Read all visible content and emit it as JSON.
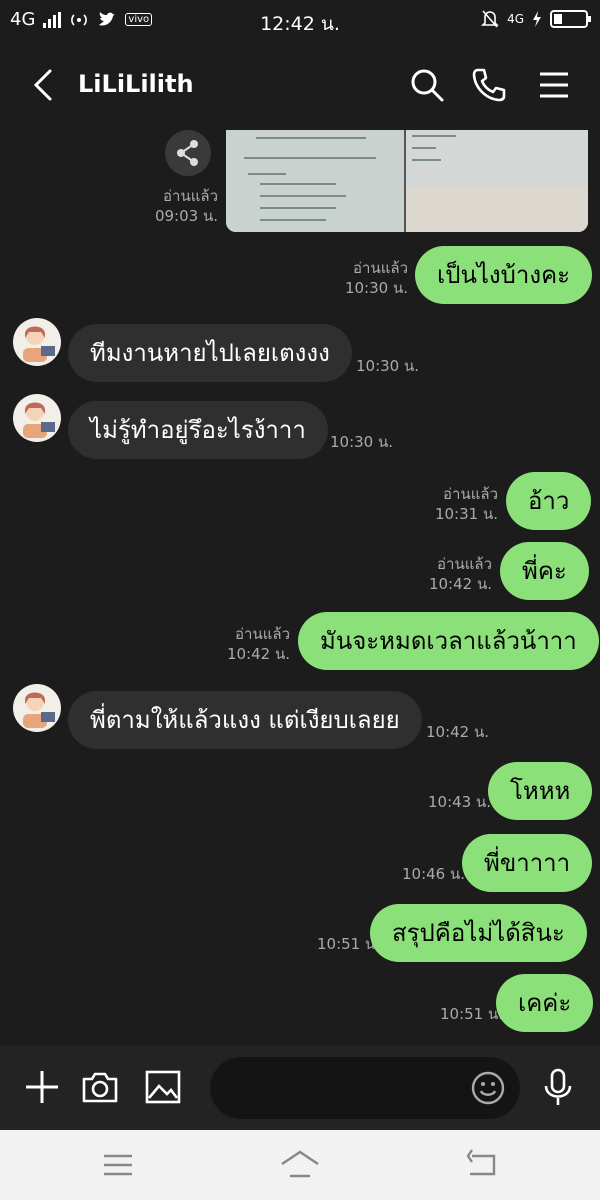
{
  "status_bar": {
    "network": "4G",
    "carrier_badge": "vivo",
    "time": "12:42 น.",
    "right_network": "4G"
  },
  "header": {
    "contact_name": "LiLiLilith"
  },
  "messages": [
    {
      "side": "image",
      "read": "อ่านแล้ว",
      "time": "09:03 น."
    },
    {
      "side": "out",
      "text": "เป็นไงบ้างคะ",
      "read": "อ่านแล้ว",
      "time": "10:30 น."
    },
    {
      "side": "in",
      "text": "ทีมงานหายไปเลยเตงงง",
      "time": "10:30 น."
    },
    {
      "side": "in",
      "text": "ไม่รู้ทำอยู่รึอะไรง้าาา",
      "time": "10:30 น."
    },
    {
      "side": "out",
      "text": "อ้าว",
      "read": "อ่านแล้ว",
      "time": "10:31 น."
    },
    {
      "side": "out",
      "text": "พี่คะ",
      "read": "อ่านแล้ว",
      "time": "10:42 น."
    },
    {
      "side": "out",
      "text": "มันจะหมดเวลาแล้วน้าาา",
      "read": "อ่านแล้ว",
      "time": "10:42 น."
    },
    {
      "side": "in",
      "text": "พี่ตามให้แล้วแงง แต่เงียบเลยย",
      "time": "10:42 น."
    },
    {
      "side": "out",
      "text": "โหหห",
      "time": "10:43 น."
    },
    {
      "side": "out",
      "text": "พี่ขาาาา",
      "time": "10:46 น."
    },
    {
      "side": "out",
      "text": "สรุปคือไม่ได้สินะ",
      "time": "10:51 น."
    },
    {
      "side": "out",
      "text": "เคค่ะ",
      "time": "10:51 น."
    }
  ],
  "input": {
    "placeholder": ""
  },
  "colors": {
    "background": "#1c1c1c",
    "outgoing_bubble": "#8ce07a",
    "incoming_bubble": "#2f2f2f",
    "meta_text": "#aaaaaa"
  },
  "icons": {
    "header": [
      "back-arrow-icon",
      "search-icon",
      "phone-icon",
      "menu-icon"
    ],
    "input_bar": [
      "plus-icon",
      "camera-icon",
      "image-icon",
      "emoji-icon",
      "microphone-icon"
    ],
    "nav_bar": [
      "recent-apps-icon",
      "home-icon",
      "back-icon"
    ]
  }
}
